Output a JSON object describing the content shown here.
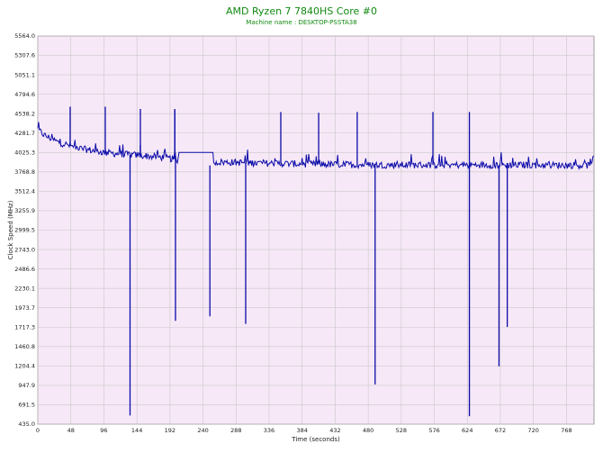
{
  "chart_data": {
    "type": "line",
    "title": "AMD Ryzen 7 7840HS Core #0",
    "subtitle": "Machine name : DESKTOP-PSSTA38",
    "xlabel": "Time (seconds)",
    "ylabel": "Clock Speed (MHz)",
    "xlim": [
      0,
      808
    ],
    "ylim": [
      435.0,
      5564.0
    ],
    "x_ticks": [
      0,
      48,
      96,
      144,
      192,
      240,
      288,
      336,
      384,
      432,
      480,
      528,
      576,
      624,
      672,
      720,
      768
    ],
    "y_ticks": [
      "435.0",
      "691.5",
      "947.9",
      "1204.4",
      "1460.8",
      "1717.3",
      "1973.7",
      "2230.1",
      "2486.6",
      "2743.0",
      "2999.5",
      "3255.9",
      "3512.4",
      "3768.8",
      "4025.3",
      "4281.7",
      "4538.2",
      "4794.6",
      "5051.1",
      "5307.6",
      "5564.0"
    ],
    "grid": true,
    "plot_background": "#f7e8f7",
    "grid_color": "#c8c8c8",
    "colors": {
      "series": "#0a0aa8",
      "title": "#118a11"
    },
    "series": [
      {
        "baseline": [
          [
            0,
            4330
          ],
          [
            10,
            4250
          ],
          [
            30,
            4160
          ],
          [
            60,
            4080
          ],
          [
            100,
            4020
          ],
          [
            150,
            3985
          ],
          [
            180,
            3960
          ],
          [
            200,
            3935
          ],
          [
            205,
            3920
          ]
        ],
        "flat_segments": [
          {
            "x": [
              205,
              240
            ],
            "y": 4025
          },
          {
            "x": [
              240,
              255
            ],
            "y": 4025
          }
        ],
        "baseline_after": [
          [
            256,
            3900
          ],
          [
            350,
            3880
          ],
          [
            400,
            3870
          ],
          [
            500,
            3860
          ],
          [
            600,
            3860
          ],
          [
            700,
            3860
          ],
          [
            808,
            3855
          ]
        ],
        "spikes_up": [
          {
            "x": 47,
            "y": 4630
          },
          {
            "x": 98,
            "y": 4630
          },
          {
            "x": 149,
            "y": 4120
          },
          {
            "x": 149,
            "y": 4600
          },
          {
            "x": 199,
            "y": 4580
          },
          {
            "x": 199,
            "y": 4600
          },
          {
            "x": 353,
            "y": 4560
          },
          {
            "x": 408,
            "y": 4550
          },
          {
            "x": 464,
            "y": 4560
          },
          {
            "x": 574,
            "y": 4560
          },
          {
            "x": 627,
            "y": 4560
          }
        ],
        "spikes_down": [
          {
            "x": 134,
            "y": 550
          },
          {
            "x": 200,
            "y": 1800
          },
          {
            "x": 250,
            "y": 1860
          },
          {
            "x": 302,
            "y": 1760
          },
          {
            "x": 490,
            "y": 960
          },
          {
            "x": 627,
            "y": 540
          },
          {
            "x": 670,
            "y": 1200
          },
          {
            "x": 682,
            "y": 1720
          }
        ]
      }
    ]
  }
}
